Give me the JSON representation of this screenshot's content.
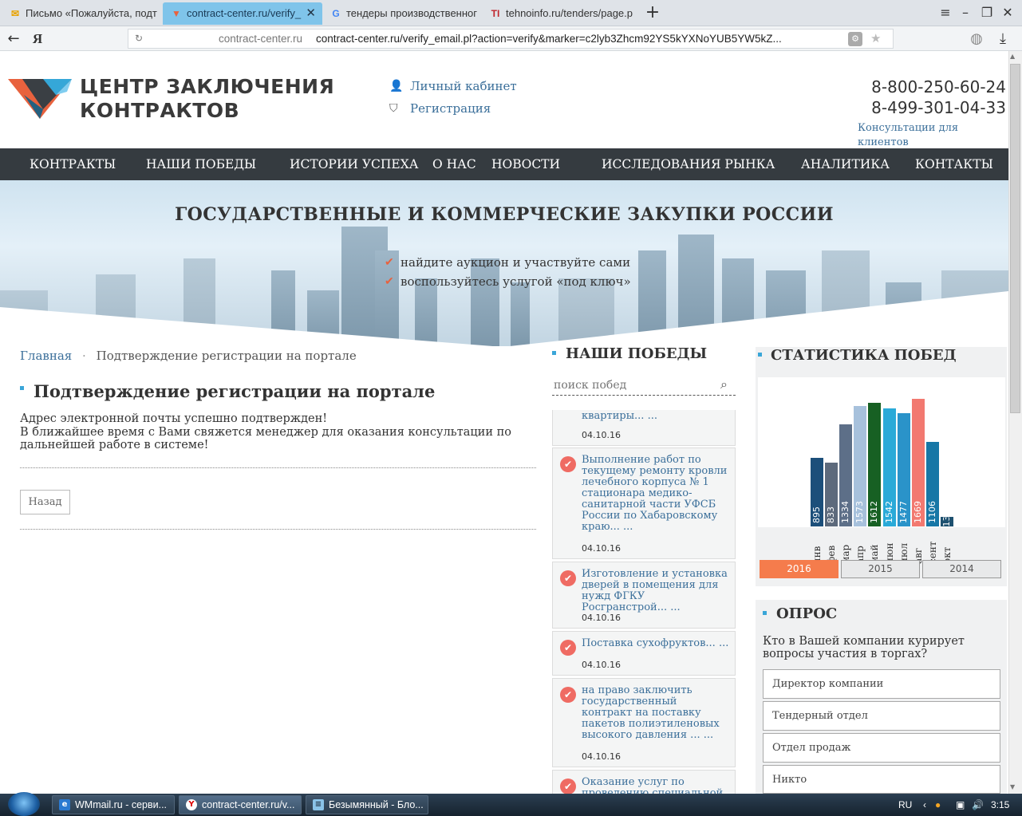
{
  "browser": {
    "tabs": [
      {
        "label": "Письмо «Пожалуйста, подт",
        "icon": "mail-icon"
      },
      {
        "label": "contract-center.ru/verify_",
        "icon": "contract-logo-icon",
        "active": true
      },
      {
        "label": "тендеры производственног",
        "icon": "google-icon"
      },
      {
        "label": "tehnoinfo.ru/tenders/page.p",
        "icon": "tehnoinfo-icon"
      }
    ],
    "yandex_letter": "Я",
    "url_host": "contract-center.ru",
    "url_full": "contract-center.ru/verify_email.pl?action=verify&marker=c2lyb3Zhcm92YS5kYXNoYUB5YW5kZ..."
  },
  "header": {
    "logo_line1": "ЦЕНТР ЗАКЛЮЧЕНИЯ",
    "logo_line2": "КОНТРАКТОВ",
    "cabinet_link": "Личный кабинет",
    "register_link": "Регистрация",
    "phone1": "8-800-250-60-24",
    "phone2": "8-499-301-04-33",
    "consult_link": "Консультации для клиентов"
  },
  "menu": [
    "КОНТРАКТЫ",
    "НАШИ ПОБЕДЫ",
    "ИСТОРИИ УСПЕХА",
    "О НАС",
    "НОВОСТИ",
    "ИССЛЕДОВАНИЯ РЫНКА",
    "АНАЛИТИКА",
    "КОНТАКТЫ"
  ],
  "hero": {
    "title": "ГОСУДАРСТВЕННЫЕ И КОММЕРЧЕСКИЕ ЗАКУПКИ РОССИИ",
    "bullets": [
      "найдите аукцион и участвуйте сами",
      "воспользуйтесь услугой «под ключ»"
    ]
  },
  "breadcrumb": {
    "home": "Главная",
    "sep": "·",
    "current": "Подтверждение регистрации на портале"
  },
  "main": {
    "title": "Подтверждение регистрации на портале",
    "line1": "Адрес электронной почты успешно подтвержден!",
    "line2": "В ближайшее время с Вами свяжется менеджер для оказания консультации по",
    "line3": "дальнейшей работе в системе!",
    "back_button": "Назад"
  },
  "wins": {
    "title": "НАШИ ПОБЕДЫ",
    "search_placeholder": "поиск побед",
    "items": [
      {
        "title": "квартиры... ...",
        "date": "04.10.16"
      },
      {
        "title": "Выполнение работ по текущему  ремонту кровли лечебного корпуса № 1 стационара медико-санитарной части УФСБ России по Хабаровскому краю... ...",
        "date": "04.10.16"
      },
      {
        "title": "Изготовление и установка дверей в помещения для нужд ФГКУ Росгранстрой... ...",
        "date": "04.10.16"
      },
      {
        "title": "Поставка сухофруктов... ...",
        "date": "04.10.16"
      },
      {
        "title": "на право заключить государственный контракт на поставку пакетов полиэтиленовых высокого давления ... ...",
        "date": "04.10.16"
      },
      {
        "title": "Оказание услуг по проведению специальной",
        "date": ""
      }
    ]
  },
  "stats": {
    "title": "СТАТИСТИКА ПОБЕД",
    "years": [
      "2016",
      "2015",
      "2014"
    ],
    "active_year": "2016"
  },
  "chart_data": {
    "type": "bar",
    "categories": [
      "янв",
      "фев",
      "мар",
      "апр",
      "май",
      "июн",
      "июл",
      "авг",
      "сент",
      "окт"
    ],
    "values": [
      895,
      833,
      1334,
      1573,
      1612,
      1542,
      1477,
      1669,
      1106,
      130
    ],
    "colors": [
      "#1c4f7a",
      "#5d6a7c",
      "#5d6f88",
      "#a7c1dc",
      "#176023",
      "#2aaad8",
      "#2a93c9",
      "#f27970",
      "#1777a6",
      "#1e5170"
    ],
    "ylim": [
      0,
      1750
    ]
  },
  "poll": {
    "title": "ОПРОС",
    "question_line1": "Кто в Вашей компании курирует",
    "question_line2": "вопросы участия в торгах?",
    "options": [
      "Директор компании",
      "Тендерный отдел",
      "Отдел продаж",
      "Никто"
    ]
  },
  "taskbar": {
    "items": [
      {
        "label": "WMmail.ru - серви...",
        "icon": "ie-icon"
      },
      {
        "label": "contract-center.ru/v...",
        "icon": "yandex-icon"
      },
      {
        "label": "Безымянный - Бло...",
        "icon": "notepad-icon"
      }
    ],
    "lang": "RU",
    "time": "3:15"
  },
  "colors": {
    "menu_bg": "#353b40",
    "accent": "#3aa6d8",
    "link": "#3b6f9a",
    "year_active": "#f57c4c"
  }
}
